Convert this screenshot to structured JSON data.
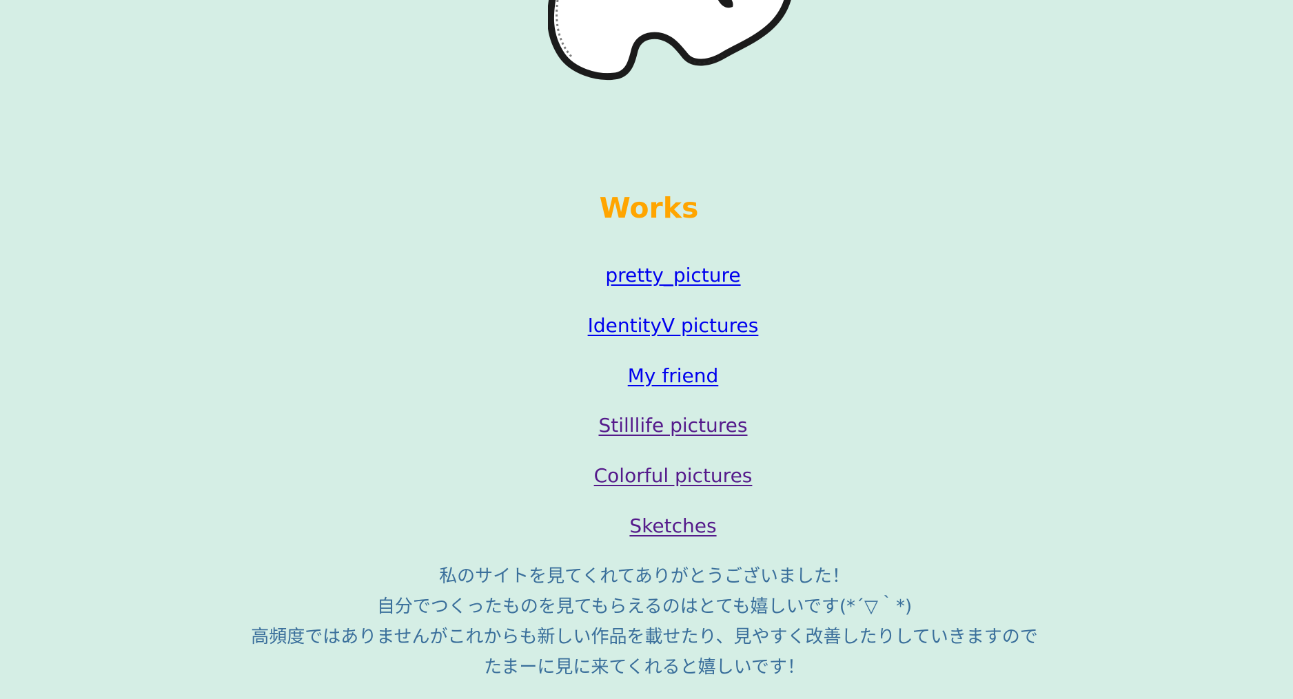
{
  "colors": {
    "background": "#d5eee5",
    "title": "#ffa500",
    "link_unvisited": "#0000ee",
    "link_visited": "#551a8b",
    "message_text": "#3a6f9b"
  },
  "header_image": {
    "icon": "doodle-character-icon"
  },
  "works": {
    "title": "Works",
    "links": [
      {
        "label": "pretty_picture",
        "visited": false
      },
      {
        "label": "IdentityV pictures",
        "visited": false
      },
      {
        "label": "My friend",
        "visited": false
      },
      {
        "label": "Stilllife pictures",
        "visited": true
      },
      {
        "label": "Colorful pictures",
        "visited": true
      },
      {
        "label": "Sketches",
        "visited": true
      }
    ]
  },
  "message": {
    "lines": [
      "私のサイトを見てくれてありがとうございました！",
      "自分でつくったものを見てもらえるのはとても嬉しいです(*´▽｀*)",
      "高頻度ではありませんがこれからも新しい作品を載せたり、見やすく改善したりしていきますので",
      "たまーに見に来てくれると嬉しいです！"
    ]
  }
}
